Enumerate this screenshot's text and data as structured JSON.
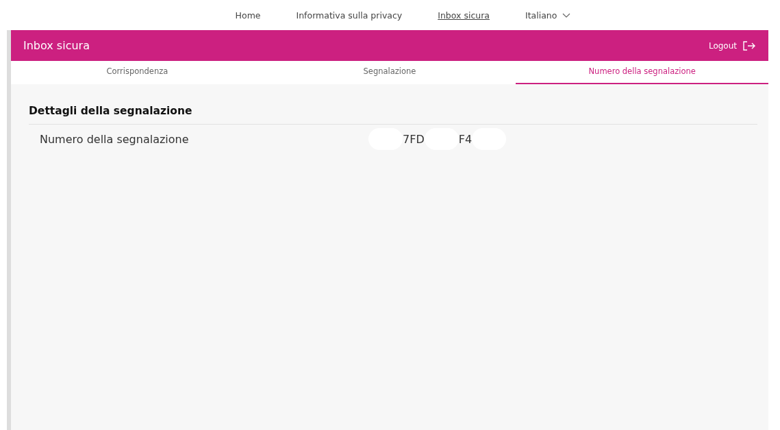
{
  "top_nav": {
    "links": [
      {
        "label": "Home",
        "selected": false
      },
      {
        "label": "Informativa sulla privacy",
        "selected": false
      },
      {
        "label": "Inbox sicura",
        "selected": true
      }
    ],
    "language": "Italiano"
  },
  "header": {
    "title": "Inbox sicura",
    "logout": "Logout"
  },
  "tabs": [
    {
      "label": "Corrispondenza",
      "selected": false
    },
    {
      "label": "Segnalazione",
      "selected": false
    },
    {
      "label": "Numero della segnalazione",
      "selected": true
    }
  ],
  "details": {
    "title": "Dettagli della segnalazione",
    "rows": [
      {
        "label": "Numero della segnalazione",
        "value_parts": [
          "7FD",
          "F4"
        ]
      }
    ]
  }
}
